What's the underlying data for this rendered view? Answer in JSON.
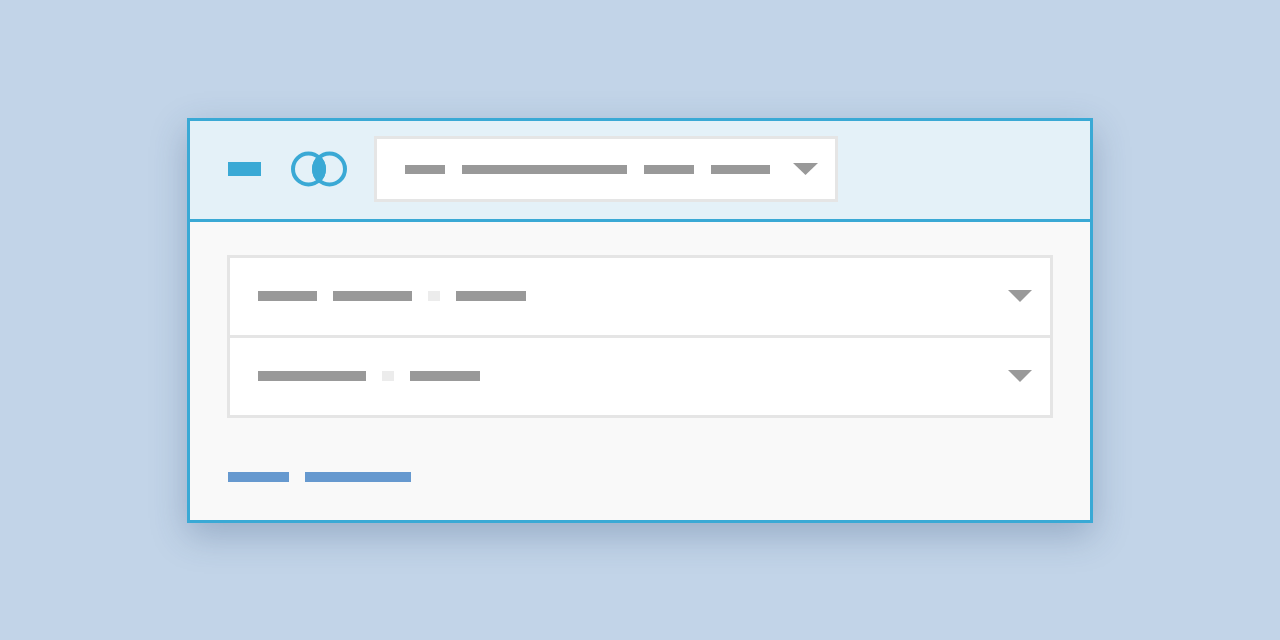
{
  "header": {
    "dropdown": {
      "segments": [
        {
          "kind": "bar"
        },
        {
          "kind": "bar"
        },
        {
          "kind": "bar"
        },
        {
          "kind": "bar"
        }
      ]
    }
  },
  "selects": [
    {
      "segments": [
        {
          "kind": "bar"
        },
        {
          "kind": "bar"
        },
        {
          "kind": "dot"
        },
        {
          "kind": "bar"
        }
      ]
    },
    {
      "segments": [
        {
          "kind": "bar"
        },
        {
          "kind": "dot"
        },
        {
          "kind": "bar"
        }
      ]
    }
  ],
  "links": [
    {
      "kind": "link"
    },
    {
      "kind": "link"
    }
  ]
}
